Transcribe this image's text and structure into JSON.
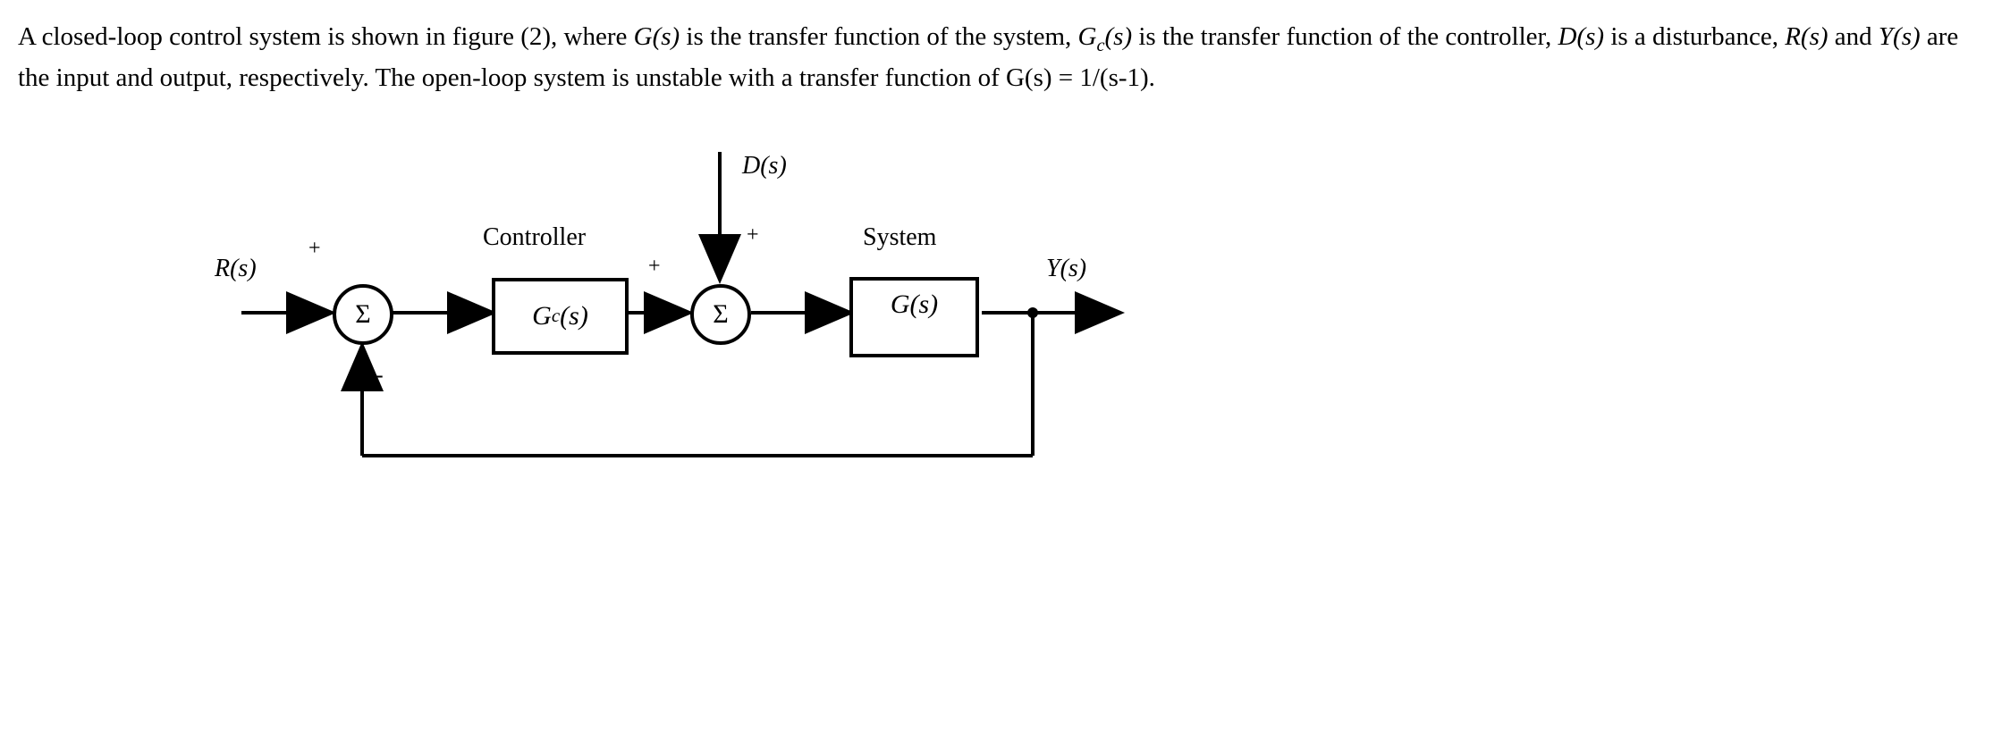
{
  "text": {
    "line1_prefix": "A closed-loop control system is shown in figure (2), where ",
    "Gs": "G(s)",
    "line1_mid1": " is the transfer function of the system, ",
    "Gcs": "G",
    "Gcs_sub": "c",
    "Gcs_tail": "(s)",
    "line2_mid1": " is the transfer function of the controller, ",
    "Ds": "D(s)",
    "line2_mid2": " is a disturbance, ",
    "Rs": "R(s)",
    "line2_and": " and ",
    "Ys": "Y(s)",
    "line2_end": " are the input and output, respectively. The open-loop system is unstable with a transfer function of G(s) = 1/(s-1)."
  },
  "diagram": {
    "input_label": "R(s)",
    "disturbance_label": "D(s)",
    "output_label": "Y(s)",
    "controller_title": "Controller",
    "system_title": "System",
    "controller_block": "G",
    "controller_block_sub": "c",
    "controller_block_tail": "(s)",
    "system_block": "G(s)",
    "sigma": "Σ",
    "plus": "+",
    "minus": "-"
  }
}
